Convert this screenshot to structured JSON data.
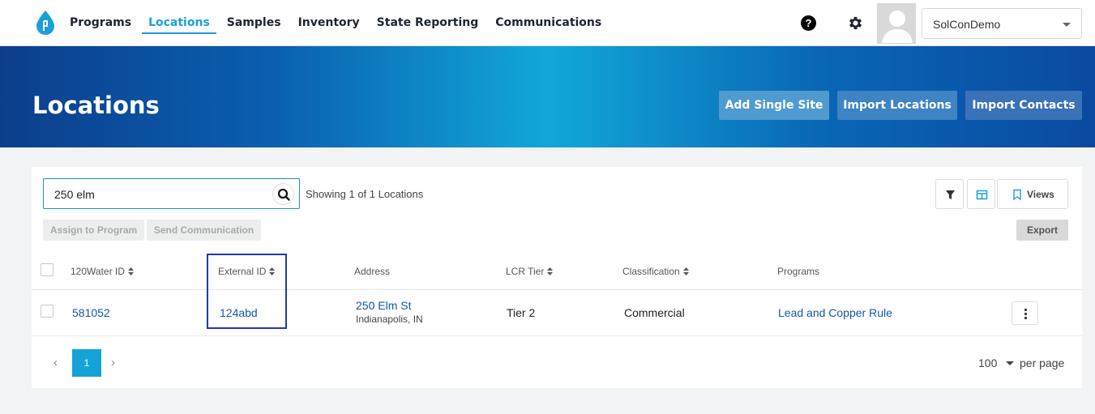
{
  "nav": {
    "items": [
      {
        "label": "Programs"
      },
      {
        "label": "Locations"
      },
      {
        "label": "Samples"
      },
      {
        "label": "Inventory"
      },
      {
        "label": "State Reporting"
      },
      {
        "label": "Communications"
      }
    ],
    "active_index": 1,
    "help_glyph": "?",
    "user_select": {
      "value": "SolConDemo"
    }
  },
  "banner": {
    "title": "Locations",
    "buttons": {
      "add_single_site": "Add Single Site",
      "import_locations": "Import Locations",
      "import_contacts": "Import Contacts"
    }
  },
  "toolbar": {
    "search": {
      "value": "250 elm"
    },
    "showing_text": "Showing 1 of 1 Locations",
    "views_label": "Views",
    "assign_label": "Assign to Program",
    "send_label": "Send Communication",
    "export_label": "Export"
  },
  "table": {
    "columns": [
      "120Water ID",
      "External ID",
      "Address",
      "LCR Tier",
      "Classification",
      "Programs"
    ],
    "rows": [
      {
        "water_id": "581052",
        "external_id": "124abd",
        "address_line1": "250 Elm St",
        "address_line2": "Indianapolis, IN",
        "lcr_tier": "Tier 2",
        "classification": "Commercial",
        "programs": "Lead and Copper Rule"
      }
    ]
  },
  "pagination": {
    "prev": "‹",
    "next": "›",
    "current_page": "1",
    "per_page_value": "100",
    "per_page_label": "per page"
  },
  "colors": {
    "accent": "#1aa0d8",
    "link": "#1557a8",
    "highlight_box": "#1d39b8"
  }
}
